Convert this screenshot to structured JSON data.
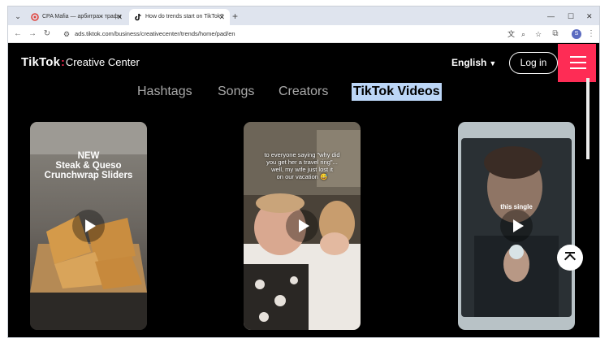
{
  "browser": {
    "tabs": [
      {
        "title": "CPA Mafia — арбитраж трафи",
        "active": false
      },
      {
        "title": "How do trends start on TikTok?",
        "active": true
      }
    ],
    "url": "ads.tiktok.com/business/creativecenter/trends/home/pad/en",
    "profile_initial": "S",
    "icons": [
      "tab-search-icon",
      "back-icon",
      "forward-icon",
      "reload-icon",
      "site-settings-icon",
      "translate-icon",
      "zoom-icon",
      "bookmark-star-icon",
      "extensions-icon",
      "kebab-menu-icon",
      "minimize-icon",
      "maximize-icon",
      "close-window-icon",
      "new-tab-icon"
    ]
  },
  "header": {
    "brand": "TikTok",
    "separator": ":",
    "product": "Creative Center",
    "language": "English",
    "login_label": "Log in",
    "accent_color": "#fe2c55"
  },
  "categories": {
    "items": [
      "Hashtags",
      "Songs",
      "Creators",
      "TikTok Videos"
    ],
    "selected": "TikTok Videos"
  },
  "videos": [
    {
      "caption_lines": [
        "NEW",
        "Steak & Queso",
        "Crunchwrap Sliders"
      ]
    },
    {
      "caption_lines": [
        "to everyone saying \"why did",
        "you get her a travel ring\"...",
        "well, my wife just lost it",
        "on our vacation 😅"
      ]
    },
    {
      "caption_lines": [
        "this single"
      ]
    }
  ]
}
